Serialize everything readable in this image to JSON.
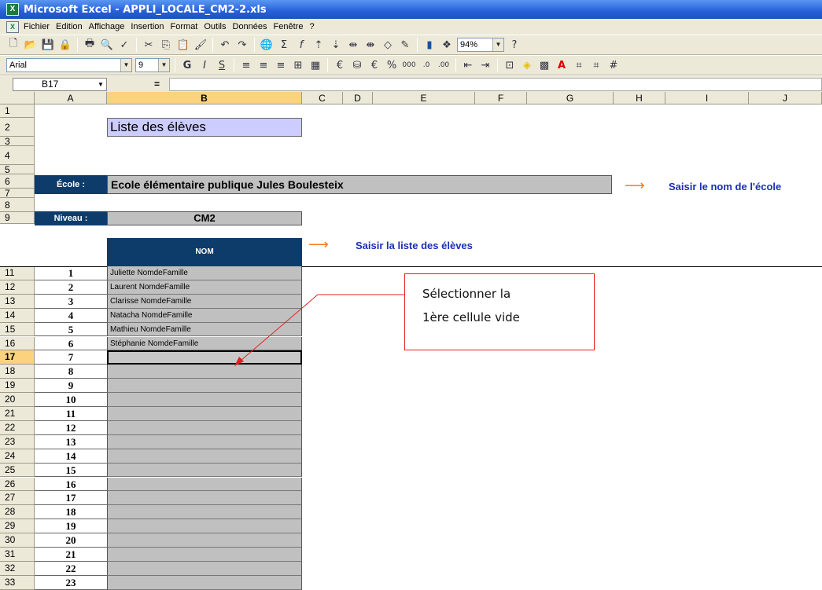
{
  "window": {
    "title": "Microsoft Excel - APPLI_LOCALE_CM2-2.xls"
  },
  "menubar": [
    "Fichier",
    "Edition",
    "Affichage",
    "Insertion",
    "Format",
    "Outils",
    "Données",
    "Fenêtre",
    "?"
  ],
  "toolbar": {
    "zoom": "94%",
    "font": "Arial",
    "size": "9"
  },
  "formula": {
    "namebox": "B17",
    "eq": "="
  },
  "columns": [
    "A",
    "B",
    "C",
    "D",
    "E",
    "F",
    "G",
    "H",
    "I",
    "J"
  ],
  "sheet": {
    "title": "Liste des élèves",
    "ecole_label": "École :",
    "ecole_value": "Ecole élémentaire publique Jules Boulesteix",
    "niveau_label": "Niveau :",
    "niveau_value": "CM2",
    "nom_header": "NOM",
    "hint_ecole": "Saisir le nom de l'école",
    "hint_liste": "Saisir la liste des élèves"
  },
  "callout": {
    "line1": "Sélectionner la",
    "line2": "1ère cellule vide"
  },
  "students": [
    {
      "n": "1",
      "name": "Juliette NomdeFamille"
    },
    {
      "n": "2",
      "name": "Laurent NomdeFamille"
    },
    {
      "n": "3",
      "name": "Clarisse NomdeFamille"
    },
    {
      "n": "4",
      "name": "Natacha NomdeFamille"
    },
    {
      "n": "5",
      "name": "Mathieu NomdeFamille"
    },
    {
      "n": "6",
      "name": "Stéphanie NomdeFamille"
    },
    {
      "n": "7",
      "name": ""
    },
    {
      "n": "8",
      "name": ""
    },
    {
      "n": "9",
      "name": ""
    },
    {
      "n": "10",
      "name": ""
    },
    {
      "n": "11",
      "name": ""
    },
    {
      "n": "12",
      "name": ""
    },
    {
      "n": "13",
      "name": ""
    },
    {
      "n": "14",
      "name": ""
    },
    {
      "n": "15",
      "name": ""
    },
    {
      "n": "16",
      "name": ""
    },
    {
      "n": "17",
      "name": ""
    },
    {
      "n": "18",
      "name": ""
    },
    {
      "n": "19",
      "name": ""
    },
    {
      "n": "20",
      "name": ""
    },
    {
      "n": "21",
      "name": ""
    },
    {
      "n": "22",
      "name": ""
    },
    {
      "n": "23",
      "name": ""
    }
  ],
  "rows": [
    "1",
    "2",
    "3",
    "4",
    "5",
    "6",
    "7",
    "8",
    "9",
    "11",
    "12",
    "13",
    "14",
    "15",
    "16",
    "17",
    "18",
    "19",
    "20",
    "21",
    "22",
    "23",
    "24",
    "25",
    "26",
    "27",
    "28",
    "29",
    "30",
    "31",
    "32",
    "33"
  ],
  "colors": {
    "accent": "#ff7a1a",
    "header_dark": "#0d3c6a",
    "hint_blue": "#1a2fb4",
    "selected": "#fbd27e"
  }
}
